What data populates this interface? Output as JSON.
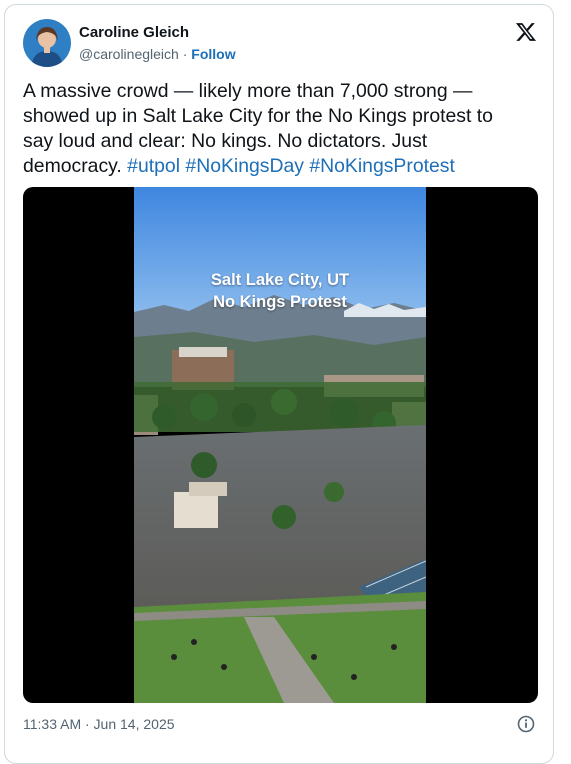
{
  "author": {
    "name": "Caroline Gleich",
    "handle": "@carolinegleich",
    "separator": " · ",
    "follow_label": "Follow"
  },
  "tweet": {
    "text_plain": "A massive crowd — likely more than 7,000 strong — showed up in Salt Lake City for the No Kings protest to say loud and clear: No kings. No dictators. Just democracy.",
    "hashtags": [
      "#utpol",
      "#NoKingsDay",
      "#NoKingsProtest"
    ]
  },
  "media": {
    "caption_line1": "Salt Lake City, UT",
    "caption_line2": "No Kings Protest"
  },
  "footer": {
    "timestamp": "11:33 AM · Jun 14, 2025"
  },
  "icons": {
    "logo": "x-logo-icon",
    "info": "info-icon"
  },
  "colors": {
    "link": "#1d6fb8",
    "secondary_text": "#536471",
    "border": "#cfd9de"
  }
}
